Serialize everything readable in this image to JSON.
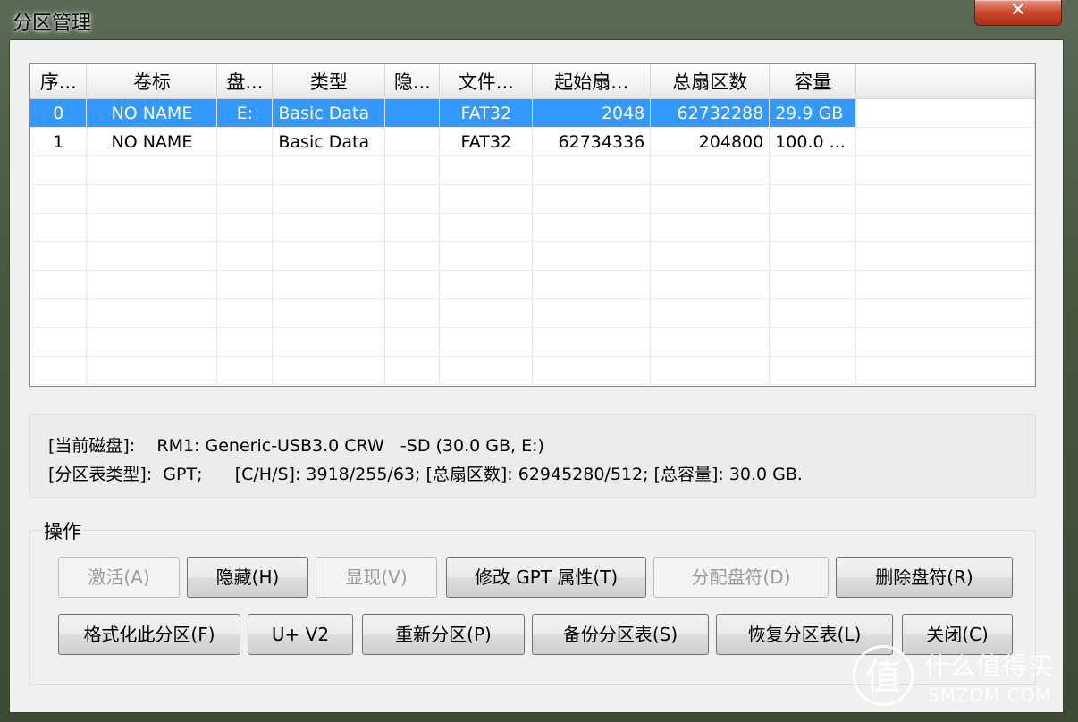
{
  "window": {
    "title": "分区管理",
    "close_glyph": "✕"
  },
  "table": {
    "headers": [
      "序...",
      "卷标",
      "盘...",
      "类型",
      "隐...",
      "文件...",
      "起始扇...",
      "总扇区数",
      "容量"
    ],
    "rows": [
      {
        "index": "0",
        "label": "NO NAME",
        "drive": "E:",
        "type": "Basic Data",
        "hidden": "",
        "fs": "FAT32",
        "start": "2048",
        "sectors": "62732288",
        "capacity": "29.9 GB",
        "selected": true
      },
      {
        "index": "1",
        "label": "NO NAME",
        "drive": "",
        "type": "Basic Data",
        "hidden": "",
        "fs": "FAT32",
        "start": "62734336",
        "sectors": "204800",
        "capacity": "100.0 ...",
        "selected": false
      }
    ],
    "selection_color": "#3399ff"
  },
  "info": {
    "line1": "[当前磁盘]:    RM1: Generic-USB3.0 CRW   -SD (30.0 GB, E:)",
    "line2": "[分区表类型]:  GPT;      [C/H/S]: 3918/255/63; [总扇区数]: 62945280/512; [总容量]: 30.0 GB."
  },
  "actions": {
    "group_label": "操作",
    "activate": "激活(A)",
    "hide": "隐藏(H)",
    "show": "显现(V)",
    "gpt_attr": "修改 GPT 属性(T)",
    "assign_letter": "分配盘符(D)",
    "delete_letter": "删除盘符(R)",
    "format": "格式化此分区(F)",
    "uv2": "U+ V2",
    "repartition": "重新分区(P)",
    "backup": "备份分区表(S)",
    "restore": "恢复分区表(L)",
    "close": "关闭(C)"
  },
  "watermark": {
    "glyph": "值",
    "text": "什么值得买",
    "sub": "SMZDM.COM"
  }
}
